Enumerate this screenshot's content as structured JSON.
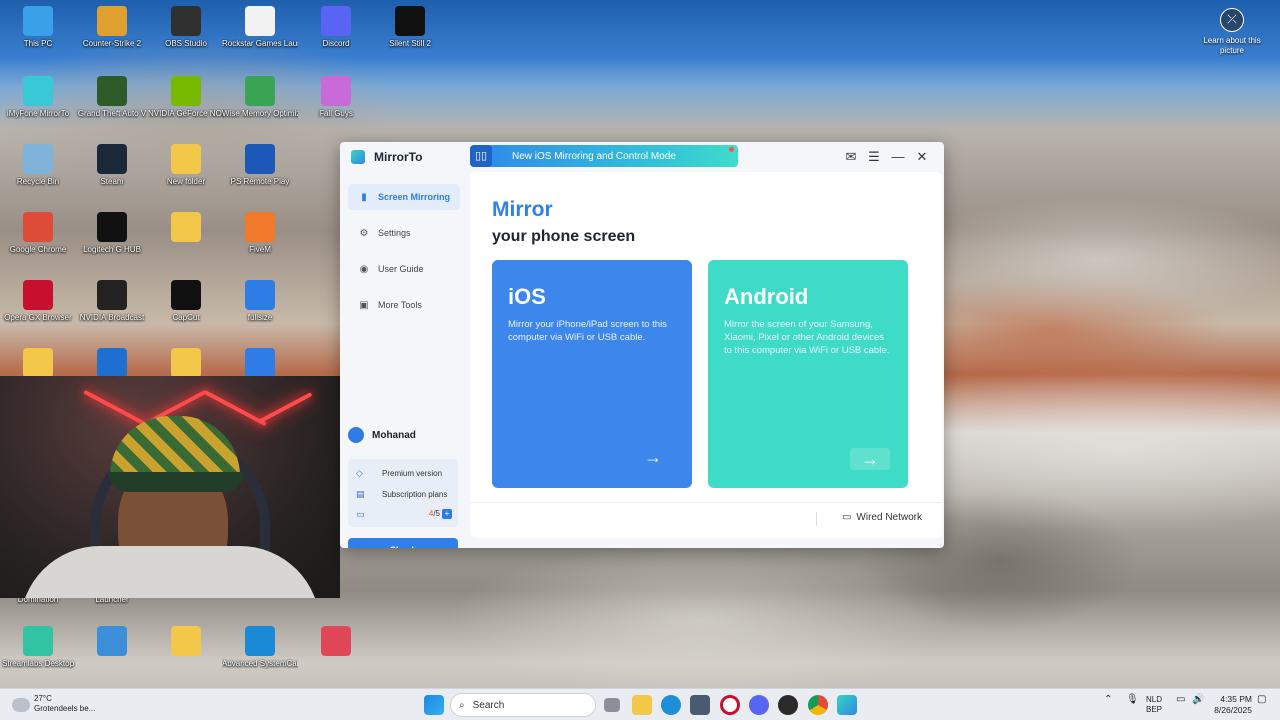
{
  "desktop": {
    "icons": [
      {
        "label": "This PC",
        "color": "#3aa0e8"
      },
      {
        "label": "Counter-Strike 2",
        "color": "#e0a030"
      },
      {
        "label": "OBS Studio",
        "color": "#303030"
      },
      {
        "label": "Rockstar Games Launcher",
        "color": "#f2f2f2"
      },
      {
        "label": "Discord",
        "color": "#5865f2"
      },
      {
        "label": "Silent Still 2",
        "color": "#101010"
      },
      {
        "label": "iMyFone MirrorTo",
        "color": "#39c8d6"
      },
      {
        "label": "Grand Theft Auto V",
        "color": "#2f5b2a"
      },
      {
        "label": "NVIDIA GeForce NOW",
        "color": "#76b900"
      },
      {
        "label": "Wise Memory Optimizer",
        "color": "#3aa455"
      },
      {
        "label": "Fall Guys",
        "color": "#c86bd8"
      },
      {
        "label": "Recycle Bin",
        "color": "#7fb3da"
      },
      {
        "label": "Steam",
        "color": "#1b2838"
      },
      {
        "label": "New folder",
        "color": "#f3c84a"
      },
      {
        "label": "PS Remote Play",
        "color": "#1d58b8"
      },
      {
        "label": "Google Chrome",
        "color": "#dd4b39"
      },
      {
        "label": "Logitech G HUB",
        "color": "#111"
      },
      {
        "label": "",
        "color": "#f3c84a"
      },
      {
        "label": "FiveM",
        "color": "#f07a2a"
      },
      {
        "label": "Opera GX Browser",
        "color": "#c8102e"
      },
      {
        "label": "NVIDIA Broadcast",
        "color": "#222"
      },
      {
        "label": "CapCut",
        "color": "#111"
      },
      {
        "label": "fullsize",
        "color": "#2e7de6"
      },
      {
        "label": "",
        "color": "#f3c84a"
      },
      {
        "label": "",
        "color": "#1f6fd1"
      },
      {
        "label": "",
        "color": "#f3c84a"
      },
      {
        "label": "",
        "color": "#2e7de6"
      },
      {
        "label": "Domination",
        "color": "#555"
      },
      {
        "label": "Launcher",
        "color": "#555"
      },
      {
        "label": "Streamlabs Desktop",
        "color": "#31c3a2"
      },
      {
        "label": "",
        "color": "#3a8fd8"
      },
      {
        "label": "",
        "color": "#f3c84a"
      },
      {
        "label": "Advanced SystemCare",
        "color": "#1b8ad6"
      },
      {
        "label": "",
        "color": "#e04858"
      }
    ],
    "learn_label": "Learn about this picture",
    "learn_glyph": "⤫"
  },
  "app": {
    "title": "MirrorTo",
    "banner_text": "New iOS Mirroring and Control Mode",
    "banner_icon": "▯▯",
    "controls": {
      "mail": "✉",
      "menu": "☰",
      "minimize": "—",
      "close": "✕"
    },
    "nav": [
      {
        "label": "Screen Mirroring",
        "icon": "▮",
        "active": true
      },
      {
        "label": "Settings",
        "icon": "⚙",
        "active": false
      },
      {
        "label": "User Guide",
        "icon": "◉",
        "active": false
      },
      {
        "label": "More Tools",
        "icon": "▣",
        "active": false
      }
    ],
    "user_name": "Mohanad",
    "premium_label": "Premium version",
    "subscription_label": "Subscription plans",
    "devices_used": "4",
    "devices_total": "/5",
    "plus_label": "+",
    "check_label": "Check",
    "heading": "Mirror",
    "subheading": "your phone screen",
    "ios": {
      "title": "iOS",
      "desc": "Mirror your iPhone/iPad screen to this computer via WiFi or USB cable.",
      "arrow": "→"
    },
    "android": {
      "title": "Android",
      "desc": "Mirror the screen of your Samsung, Xiaomi, Pixel or other Android devices to this computer via WiFi or USB cable.",
      "arrow": "→"
    },
    "wired_label": "Wired Network",
    "wired_icon": "▭"
  },
  "taskbar": {
    "temp": "27°C",
    "weather_text": "Grotendeels be...",
    "search_label": "Search",
    "search_icon": "⌕",
    "lang1": "NLD",
    "lang2": "BEP",
    "time": "4:35 PM",
    "date": "8/26/2025"
  }
}
